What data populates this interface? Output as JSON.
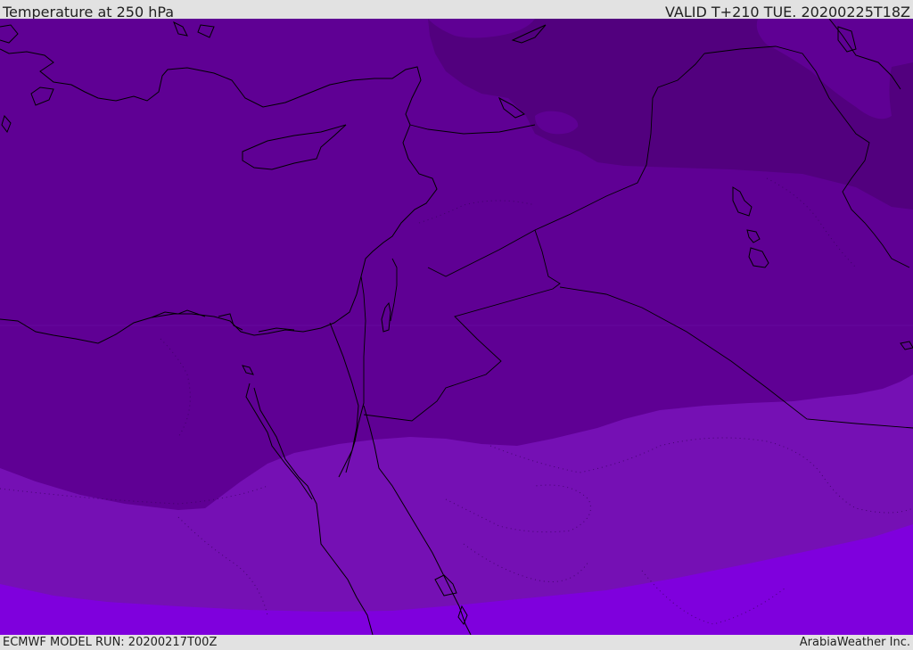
{
  "header": {
    "title": "Temperature at 250 hPa",
    "valid": "VALID T+210 TUE. 20200225T18Z"
  },
  "footer": {
    "model_run": "ECMWF MODEL RUN: 20200217T00Z",
    "credit": "ArabiaWeather Inc."
  },
  "map": {
    "colors": {
      "coldest_band": "#52007e",
      "cold_band": "#5f0094",
      "mid_band": "#7510b4",
      "warm_band": "#7f00dd",
      "coastline": "#000000"
    }
  }
}
